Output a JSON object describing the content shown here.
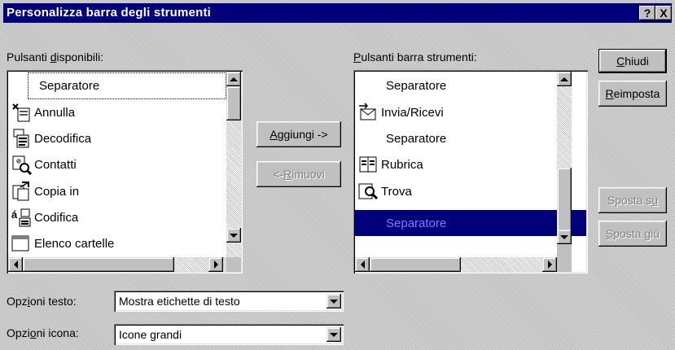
{
  "dialog": {
    "title": "Personalizza barra degli strumenti",
    "help_label": "?",
    "close_label": "X"
  },
  "available": {
    "label_pre": "Pulsanti ",
    "label_mnemonic": "d",
    "label_post": "isponibili:",
    "items": [
      {
        "label": "Separatore",
        "icon": ""
      },
      {
        "label": "Annulla",
        "icon": "undo-icon"
      },
      {
        "label": "Decodifica",
        "icon": "decode-icon"
      },
      {
        "label": "Contatti",
        "icon": "contacts-icon"
      },
      {
        "label": "Copia in",
        "icon": "copy-to-icon"
      },
      {
        "label": "Codifica",
        "icon": "encode-icon"
      },
      {
        "label": "Elenco cartelle",
        "icon": "folder-list-icon"
      }
    ]
  },
  "current": {
    "label_mnemonic": "P",
    "label_post": "ulsanti barra strumenti:",
    "items": [
      {
        "label": "Separatore",
        "icon": ""
      },
      {
        "label": "Invia/Ricevi",
        "icon": "send-receive-icon"
      },
      {
        "label": "Separatore",
        "icon": ""
      },
      {
        "label": "Rubrica",
        "icon": "address-book-icon"
      },
      {
        "label": "Trova",
        "icon": "find-icon"
      },
      {
        "label": "Separatore",
        "icon": "",
        "selected": true
      }
    ]
  },
  "buttons": {
    "add_mnemonic": "A",
    "add_post": "ggiungi ->",
    "remove_pre": "<- ",
    "remove_mnemonic": "R",
    "remove_post": "imuovi",
    "close_mnemonic": "C",
    "close_post": "hiudi",
    "reset_mnemonic": "R",
    "reset_post": "eimposta",
    "move_up_pre": "Sposta s",
    "move_up_mnemonic": "u",
    "move_down_mnemonic": "S",
    "move_down_post": "posta giù"
  },
  "text_options": {
    "label_pre": "Opz",
    "label_mnemonic": "i",
    "label_post": "oni testo:",
    "value": "Mostra etichette di testo"
  },
  "icon_options": {
    "label_pre": "Opzi",
    "label_mnemonic": "o",
    "label_post": "ni icona:",
    "value": "Icone grandi"
  },
  "colors": {
    "titlebar": "#00007b",
    "selection": "#00007b",
    "face": "#c0c0c0"
  }
}
